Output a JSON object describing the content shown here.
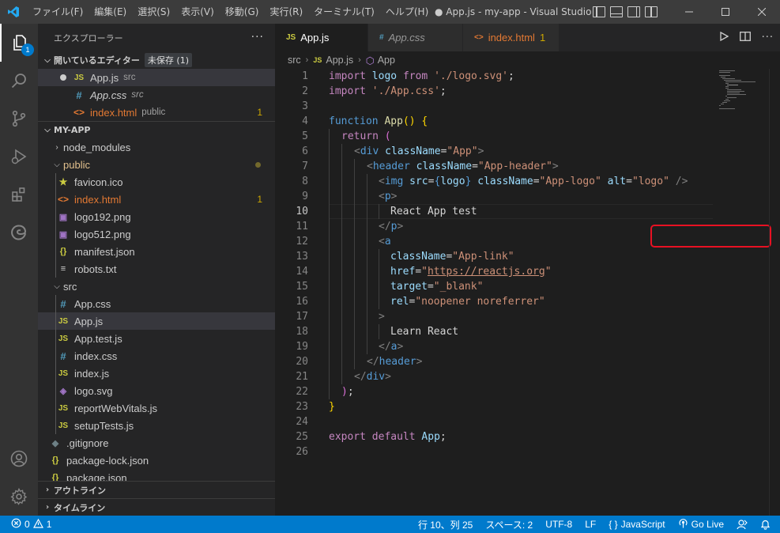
{
  "titlebar": {
    "menu": [
      "ファイル(F)",
      "編集(E)",
      "選択(S)",
      "表示(V)",
      "移動(G)",
      "実行(R)",
      "ターミナル(T)",
      "ヘルプ(H)"
    ],
    "title": "● App.js - my-app - Visual Studio C..."
  },
  "activitybar": {
    "explorer_badge": "1"
  },
  "sidebar": {
    "header": "エクスプローラー",
    "more": "···",
    "open_editors": {
      "title": "開いているエディター",
      "unsaved": "未保存 (1)",
      "items": [
        {
          "name": "App.js",
          "desc": "src",
          "icon": "JS"
        },
        {
          "name": "App.css",
          "desc": "src",
          "icon": "#"
        },
        {
          "name": "index.html",
          "desc": "public",
          "icon": "<>",
          "problems": "1"
        }
      ]
    },
    "project": {
      "title": "MY-APP",
      "items": [
        {
          "name": "node_modules",
          "type": "folder-closed"
        },
        {
          "name": "public",
          "type": "folder-open"
        },
        {
          "name": "favicon.ico",
          "icon": "★"
        },
        {
          "name": "index.html",
          "icon": "<>",
          "problems": "1"
        },
        {
          "name": "logo192.png",
          "icon": "▣"
        },
        {
          "name": "logo512.png",
          "icon": "▣"
        },
        {
          "name": "manifest.json",
          "icon": "{}"
        },
        {
          "name": "robots.txt",
          "icon": "≡"
        },
        {
          "name": "src",
          "type": "folder-open"
        },
        {
          "name": "App.css",
          "icon": "#"
        },
        {
          "name": "App.js",
          "icon": "JS"
        },
        {
          "name": "App.test.js",
          "icon": "JS"
        },
        {
          "name": "index.css",
          "icon": "#"
        },
        {
          "name": "index.js",
          "icon": "JS"
        },
        {
          "name": "logo.svg",
          "icon": "◈"
        },
        {
          "name": "reportWebVitals.js",
          "icon": "JS"
        },
        {
          "name": "setupTests.js",
          "icon": "JS"
        },
        {
          "name": ".gitignore",
          "icon": "◆"
        },
        {
          "name": "package-lock.json",
          "icon": "{}"
        },
        {
          "name": "package.json",
          "icon": "{}"
        }
      ]
    },
    "outline": "アウトライン",
    "timeline": "タイムライン"
  },
  "editor": {
    "tabs": [
      {
        "icon": "JS",
        "label": "App.js"
      },
      {
        "icon": "#",
        "label": "App.css"
      },
      {
        "icon": "<>",
        "label": "index.html",
        "problems": "1"
      }
    ],
    "breadcrumb": [
      "src",
      "App.js",
      "App"
    ],
    "current_line": 10,
    "line_numbers": [
      "1",
      "2",
      "3",
      "4",
      "5",
      "6",
      "7",
      "8",
      "9",
      "10",
      "11",
      "12",
      "13",
      "14",
      "15",
      "16",
      "17",
      "18",
      "19",
      "20",
      "21",
      "22",
      "23",
      "24",
      "25",
      "26"
    ],
    "code": {
      "l1": [
        "import",
        "logo",
        "from",
        "'./logo.svg'",
        ";"
      ],
      "l2": [
        "import",
        "'./App.css'",
        ";"
      ],
      "l4": [
        "function",
        "App",
        "(",
        ")",
        "{"
      ],
      "l5": [
        "return",
        "("
      ],
      "l6": [
        "<",
        "div",
        "className",
        "=",
        "\"App\"",
        ">"
      ],
      "l7": [
        "<",
        "header",
        "className",
        "=",
        "\"App-header\"",
        ">"
      ],
      "l8": [
        "<",
        "img",
        "src",
        "=",
        "{",
        "logo",
        "}",
        "className",
        "=",
        "\"App-logo\"",
        "alt",
        "=",
        "\"logo\"",
        "/>"
      ],
      "l9": [
        "<",
        "p",
        ">"
      ],
      "l10": "React App test",
      "l11": [
        "</",
        "p",
        ">"
      ],
      "l12": [
        "<",
        "a"
      ],
      "l13": [
        "className",
        "=",
        "\"App-link\""
      ],
      "l14": [
        "href",
        "=",
        "\"",
        "https://reactjs.org",
        "\""
      ],
      "l15": [
        "target",
        "=",
        "\"_blank\""
      ],
      "l16": [
        "rel",
        "=",
        "\"noopener noreferrer\""
      ],
      "l17": [
        ">"
      ],
      "l18": "Learn React",
      "l19": [
        "</",
        "a",
        ">"
      ],
      "l20": [
        "</",
        "header",
        ">"
      ],
      "l21": [
        "</",
        "div",
        ">"
      ],
      "l22": [
        ")",
        ";"
      ],
      "l23": [
        "}"
      ],
      "l25": [
        "export",
        "default",
        "App",
        ";"
      ]
    }
  },
  "statusbar": {
    "errors": "0",
    "warnings": "1",
    "position": "行 10、列 25",
    "spaces": "スペース: 2",
    "encoding": "UTF-8",
    "eol": "LF",
    "language": "JavaScript",
    "golive": "Go Live"
  }
}
